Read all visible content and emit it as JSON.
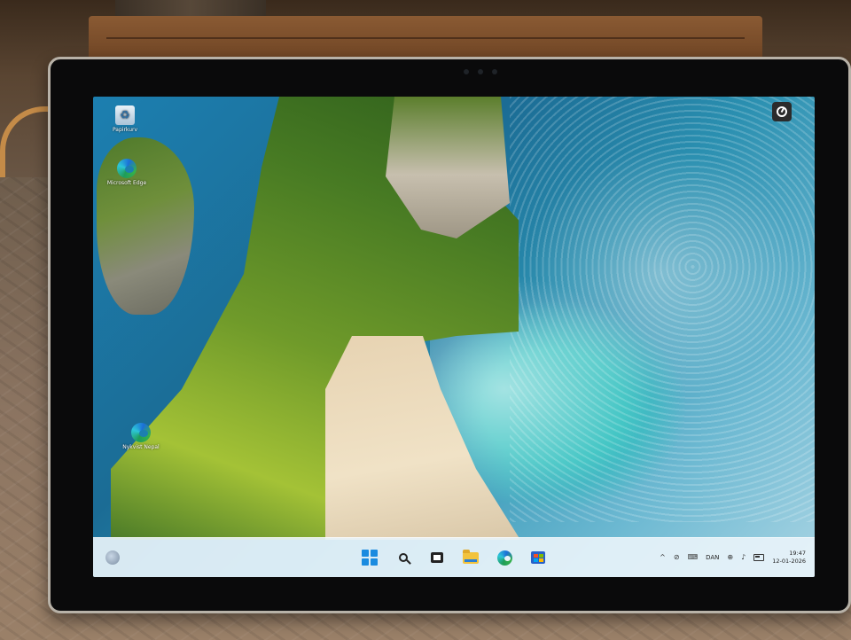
{
  "desktop": {
    "icons": [
      {
        "label": "Papirkurv",
        "icon": "recycle-bin-icon"
      },
      {
        "label": "Microsoft Edge",
        "icon": "edge-icon"
      },
      {
        "label": "Nykvist Nepal",
        "icon": "edge-icon"
      }
    ],
    "top_right_icon": "clock-shortcut-icon"
  },
  "taskbar": {
    "center_icons": [
      "start-icon",
      "search-icon",
      "task-view-icon",
      "file-explorer-icon",
      "edge-icon",
      "store-icon"
    ],
    "tray": {
      "chevron": "^",
      "language": "DAN",
      "time": "19:47",
      "date": "12-01-2026"
    }
  },
  "colors": {
    "taskbar_bg": "#e8f3fa",
    "start_blue": "#1a8be0",
    "folder_yellow": "#f2c33d",
    "tablet_bezel": "#0a0a0b"
  }
}
